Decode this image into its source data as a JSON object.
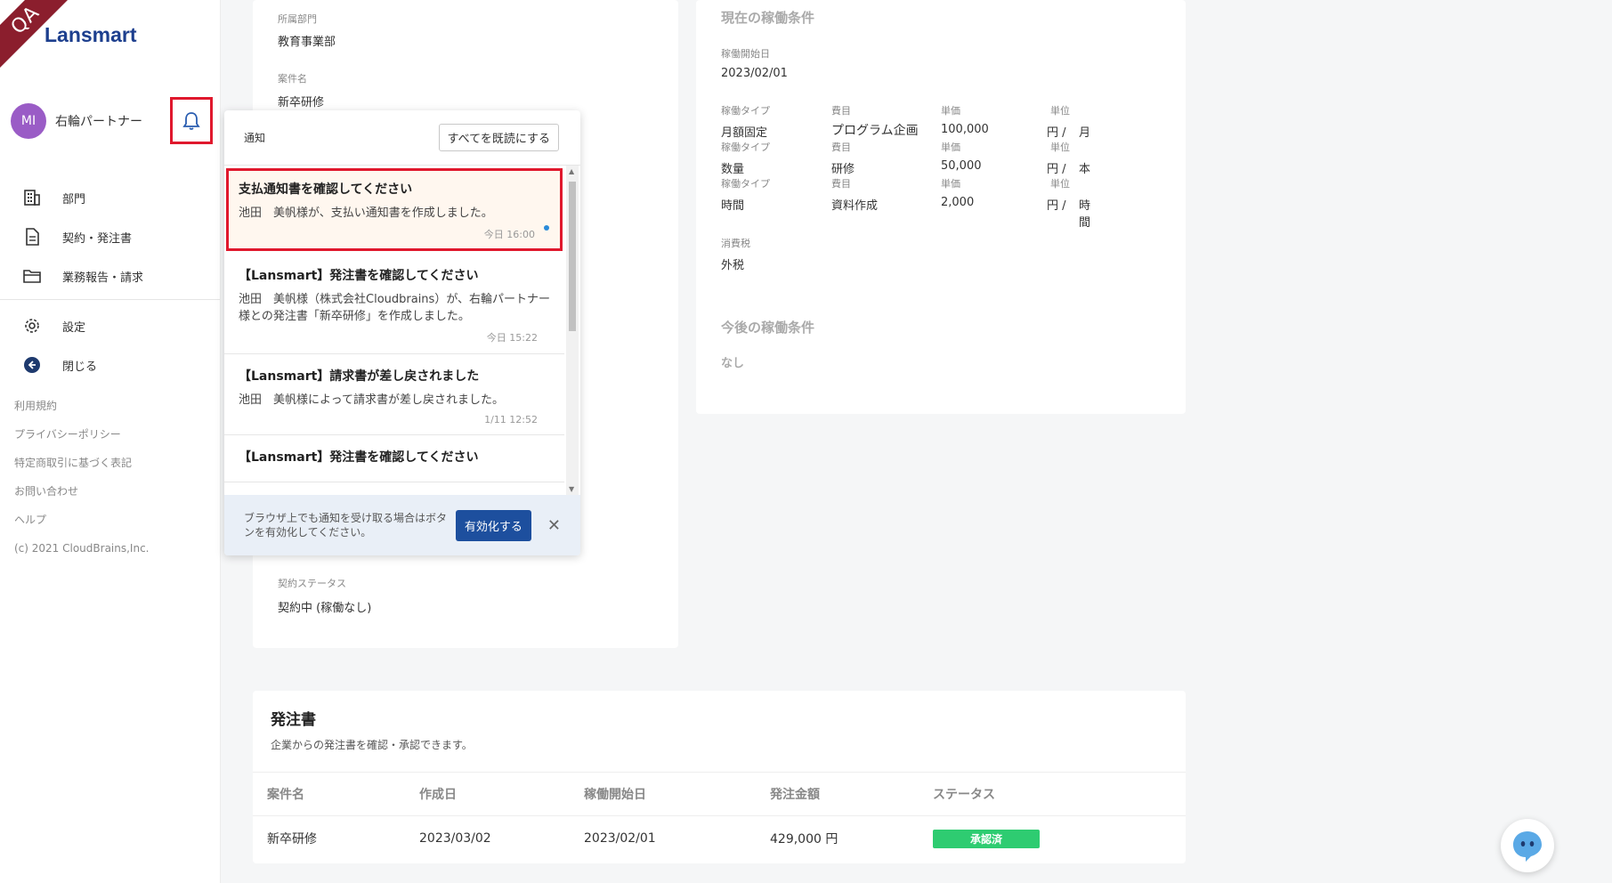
{
  "app": {
    "logo_text": "Lansmart",
    "env_badge": "QA"
  },
  "user": {
    "initials": "MI",
    "name": "右輪パートナー"
  },
  "nav": {
    "items": [
      {
        "label": "部門",
        "icon": "building-icon"
      },
      {
        "label": "契約・発注書",
        "icon": "document-icon"
      },
      {
        "label": "業務報告・請求",
        "icon": "folder-icon"
      }
    ],
    "settings": "設定",
    "close": "閉じる"
  },
  "footer": {
    "links": [
      "利用規約",
      "プライバシーポリシー",
      "特定商取引に基づく表記",
      "お問い合わせ",
      "ヘルプ"
    ],
    "copyright": "(c) 2021 CloudBrains,Inc."
  },
  "contract": {
    "dept_label": "所属部門",
    "dept_value": "教育事業部",
    "project_label": "案件名",
    "project_value": "新卒研修",
    "status_label": "契約ステータス",
    "status_value": "契約中 (稼働なし)"
  },
  "notifications": {
    "title": "通知",
    "mark_all": "すべてを既読にする",
    "items": [
      {
        "title": "支払通知書を確認してください",
        "body": "池田　美帆様が、支払い通知書を作成しました。",
        "time": "今日 16:00"
      },
      {
        "title": "【Lansmart】発注書を確認してください",
        "body": "池田　美帆様（株式会社Cloudbrains）が、右輪パートナー様との発注書「新卒研修」を作成しました。",
        "time": "今日 15:22"
      },
      {
        "title": "【Lansmart】請求書が差し戻されました",
        "body": "池田　美帆様によって請求書が差し戻されました。",
        "time": "1/11 12:52"
      },
      {
        "title": "【Lansmart】発注書を確認してください",
        "body": "",
        "time": ""
      }
    ],
    "footer_text": "ブラウザ上でも通知を受け取る場合はボタンを有効化してください。",
    "enable_button": "有効化する"
  },
  "current_conditions": {
    "heading": "現在の稼働条件",
    "start_label": "稼働開始日",
    "start_value": "2023/02/01",
    "col_labels": {
      "type": "稼働タイプ",
      "item": "費目",
      "price": "単価",
      "unit": "単位"
    },
    "rows": [
      {
        "type": "月額固定",
        "item": "プログラム企画",
        "price": "100,000",
        "yen": "円 /",
        "unit": "月"
      },
      {
        "type": "数量",
        "item": "研修",
        "price": "50,000",
        "yen": "円 /",
        "unit": "本"
      },
      {
        "type": "時間",
        "item": "資料作成",
        "price": "2,000",
        "yen": "円 /",
        "unit": "時間"
      }
    ],
    "tax_label": "消費税",
    "tax_value": "外税"
  },
  "future_conditions": {
    "heading": "今後の稼働条件",
    "value": "なし"
  },
  "orders": {
    "heading": "発注書",
    "subtitle": "企業からの発注書を確認・承認できます。",
    "columns": [
      "案件名",
      "作成日",
      "稼働開始日",
      "発注金額",
      "ステータス"
    ],
    "rows": [
      {
        "project": "新卒研修",
        "created": "2023/03/02",
        "start": "2023/02/01",
        "amount": "429,000 円",
        "status": "承認済"
      }
    ]
  }
}
